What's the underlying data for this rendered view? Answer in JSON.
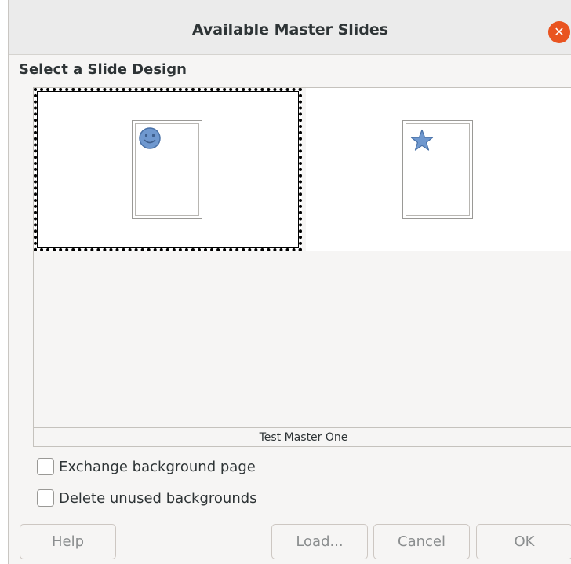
{
  "dialog": {
    "title": "Available Master Slides",
    "close_icon": "close-icon",
    "accent_color": "#e95420"
  },
  "design_section": {
    "label": "Select a Slide Design",
    "designs": [
      {
        "icon": "smiley-icon",
        "selected": true
      },
      {
        "icon": "star-icon",
        "selected": false
      }
    ],
    "selected_name": "Test Master One"
  },
  "options": {
    "exchange_background": {
      "label": "Exchange background page",
      "checked": false
    },
    "delete_unused": {
      "label": "Delete unused backgrounds",
      "checked": false
    }
  },
  "buttons": {
    "help": "Help",
    "load": "Load...",
    "cancel": "Cancel",
    "ok": "OK"
  }
}
